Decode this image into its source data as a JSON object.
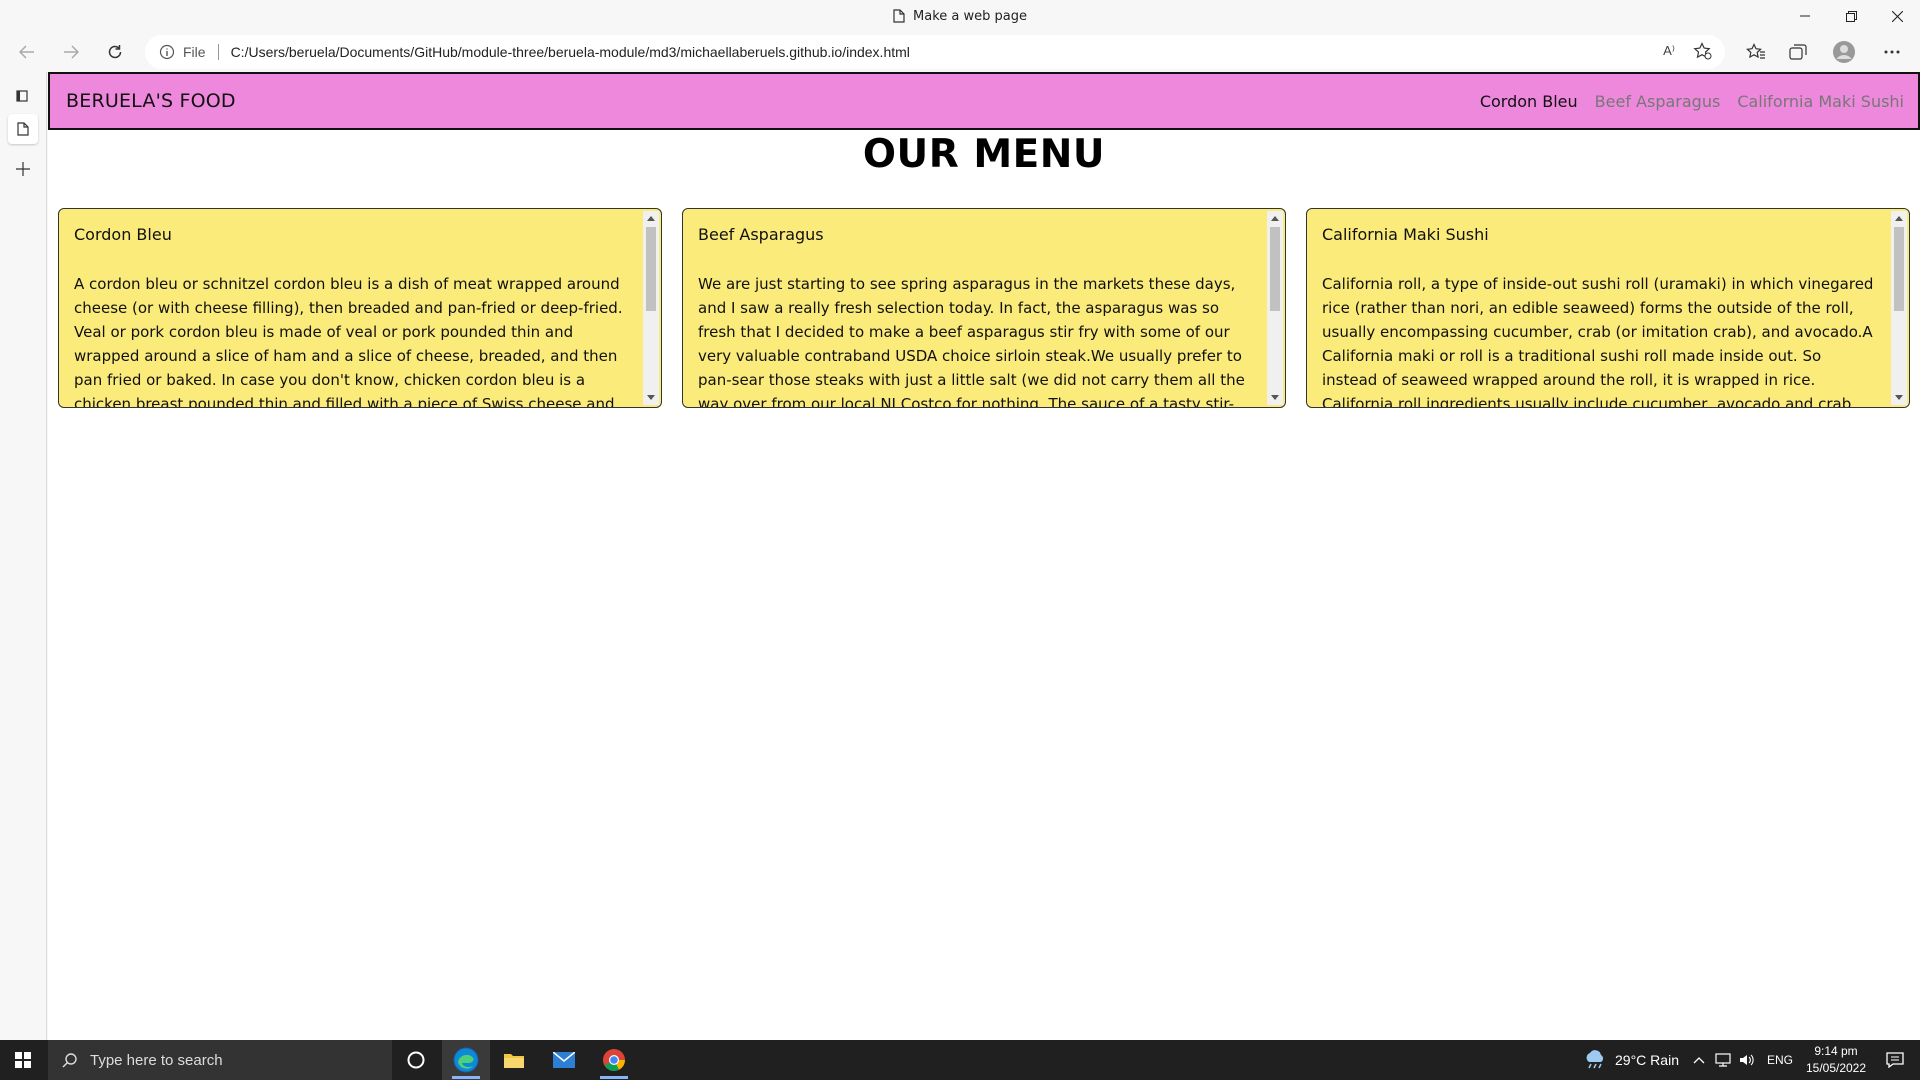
{
  "window": {
    "title": "Make a web page"
  },
  "address_bar": {
    "info_label": "File",
    "url": "C:/Users/beruela/Documents/GitHub/module-three/beruela-module/md3/michaellaberuels.github.io/index.html",
    "read_aloud_label": "A⁾"
  },
  "site": {
    "brand": "BERUELA'S FOOD",
    "nav_links": [
      "Cordon Bleu",
      "Beef Asparagus",
      "California Maki Sushi"
    ],
    "active_link": "Cordon Bleu",
    "heading": "OUR MENU",
    "cards": [
      {
        "title": "Cordon Bleu",
        "text": "A cordon bleu or schnitzel cordon bleu is a dish of meat wrapped around cheese (or with cheese filling), then breaded and pan-fried or deep-fried. Veal or pork cordon bleu is made of veal or pork pounded thin and wrapped around a slice of ham and a slice of cheese, breaded, and then pan fried or baked. In case you don't know, chicken cordon bleu is a chicken breast pounded thin and filled with a piece of Swiss cheese and ham, then rolled up, breaded and baked."
      },
      {
        "title": "Beef Asparagus",
        "text": "We are just starting to see spring asparagus in the markets these days, and I saw a really fresh selection today. In fact, the asparagus was so fresh that I decided to make a beef asparagus stir fry with some of our very valuable contraband USDA choice sirloin steak.We usually prefer to pan-sear those steaks with just a little salt (we did not carry them all the way over from our local NJ Costco for nothing. The sauce of a tasty stir-fry is what the people love."
      },
      {
        "title": "California Maki Sushi",
        "text": "California roll, a type of inside-out sushi roll (uramaki) in which vinegared rice (rather than nori, an edible seaweed) forms the outside of the roll, usually encompassing cucumber, crab (or imitation crab), and avocado.A California maki or roll is a traditional sushi roll made inside out. So instead of seaweed wrapped around the roll, it is wrapped in rice. California roll ingredients usually include cucumber, avocado and crab meat or imitation crab. It's a very good starter roll."
      }
    ]
  },
  "taskbar": {
    "search_placeholder": "Type here to search",
    "weather": "29°C  Rain",
    "language": "ENG",
    "time": "9:14 pm",
    "date": "15/05/2022"
  },
  "colors": {
    "nav_bg": "#ee88dd",
    "card_bg": "#fbeb7a"
  },
  "icons": {
    "page": "page-icon",
    "back": "back-arrow-icon",
    "forward": "forward-arrow-icon",
    "refresh": "refresh-icon",
    "info": "info-icon",
    "windows": "windows-start-icon",
    "cortana": "cortana-circle-icon",
    "edge": "edge-icon",
    "explorer": "folder-icon",
    "mail": "mail-icon",
    "chrome": "chrome-icon"
  }
}
